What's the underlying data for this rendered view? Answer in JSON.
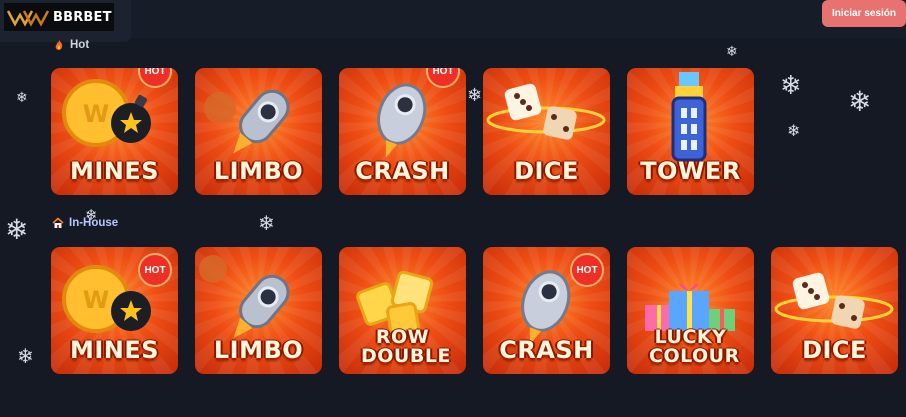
{
  "header": {
    "logo_text": "BBRBET",
    "login_label": "Iniciar sesión"
  },
  "sections": [
    {
      "title": "Hot",
      "icon": "fire-icon",
      "games": [
        {
          "title": "MINES",
          "hot": true
        },
        {
          "title": "LIMBO",
          "hot": false
        },
        {
          "title": "CRASH",
          "hot": true
        },
        {
          "title": "DICE",
          "hot": false
        },
        {
          "title": "TOWER",
          "hot": false
        }
      ]
    },
    {
      "title": "In-House",
      "icon": "house-icon",
      "games": [
        {
          "title": "MINES",
          "hot": true
        },
        {
          "title": "LIMBO",
          "hot": false
        },
        {
          "title": "ROW DOUBLE",
          "hot": false
        },
        {
          "title": "CRASH",
          "hot": true
        },
        {
          "title": "LUCKY COLOUR",
          "hot": false
        },
        {
          "title": "DICE",
          "hot": false
        }
      ]
    }
  ],
  "badge_label": "HOT",
  "colors": {
    "background": "#141923",
    "accent": "#e8726f",
    "card": "#ee4e14"
  }
}
